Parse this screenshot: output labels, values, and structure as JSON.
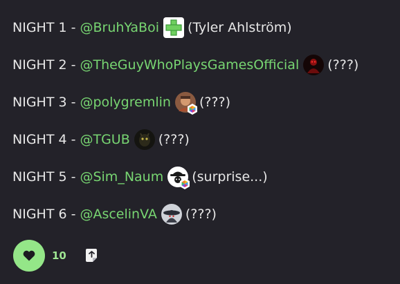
{
  "post": {
    "lines": [
      {
        "label": "NIGHT 1 -",
        "mention": "@BruhYaBoi",
        "note": "(Tyler Ahlström)",
        "avatar_icon": "green-cross-avatar-icon"
      },
      {
        "label": "NIGHT 2 -",
        "mention": "@TheGuyWhoPlaysGamesOfficial",
        "note": "(???)",
        "avatar_icon": "red-figure-avatar-icon"
      },
      {
        "label": "NIGHT 3 -",
        "mention": "@polygremlin",
        "note": "(???)",
        "avatar_icon": "character-avatar-icon"
      },
      {
        "label": "NIGHT 4 -",
        "mention": "@TGUB",
        "note": "(???)",
        "avatar_icon": "dark-creature-avatar-icon"
      },
      {
        "label": "NIGHT 5 -",
        "mention": "@Sim_Naum",
        "note": "(surprise...)",
        "avatar_icon": "hat-figure-avatar-icon"
      },
      {
        "label": "NIGHT 6 -",
        "mention": "@AscelinVA",
        "note": "(???)",
        "avatar_icon": "dark-hat-avatar-icon"
      }
    ]
  },
  "actions": {
    "like_count": "10",
    "like_icon": "heart-icon",
    "share_icon": "share-icon"
  },
  "colors": {
    "background": "#232229",
    "mention": "#78d672",
    "like_button": "#94e688",
    "like_count": "#9ee692",
    "text": "#e6e6e6"
  }
}
